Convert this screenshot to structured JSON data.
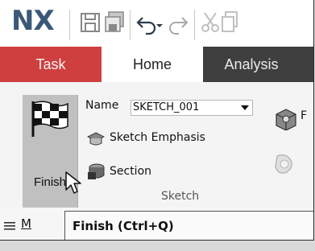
{
  "app": {
    "logo": "NX"
  },
  "quick_access": {
    "icons": [
      "save-icon",
      "save-all-icon",
      "undo-icon",
      "undo-dropdown-icon",
      "redo-icon",
      "cut-icon",
      "copy-icon"
    ]
  },
  "tabs": [
    {
      "label": "Task",
      "active": false
    },
    {
      "label": "Home",
      "active": true
    },
    {
      "label": "Analysis",
      "active": false
    }
  ],
  "ribbon": {
    "finish_label": "Finish",
    "name_label": "Name",
    "name_value": "SKETCH_001",
    "sketch_emphasis_label": "Sketch Emphasis",
    "section_label": "Section",
    "group_label": "Sketch",
    "cut_off_right_label": "F"
  },
  "bottom": {
    "menu_letter": "M"
  },
  "tooltip": {
    "text": "Finish (Ctrl+Q)"
  },
  "colors": {
    "logo": "#3b5878",
    "task_tab": "#cf3f3f",
    "tab_bar": "#3f3f3f",
    "finish_bg": "#c0c0c0"
  }
}
